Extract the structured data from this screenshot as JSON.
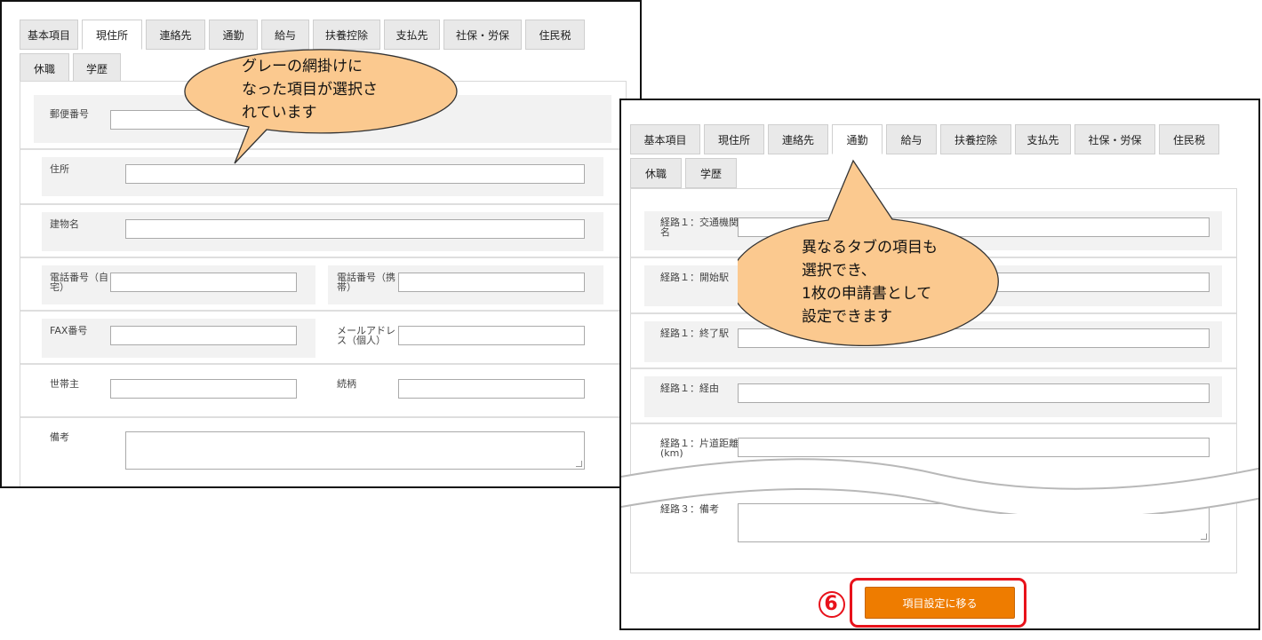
{
  "left_panel": {
    "tabs_row1": [
      "基本項目",
      "現住所",
      "連絡先",
      "通勤",
      "給与",
      "扶養控除",
      "支払先",
      "社保・労保",
      "住民税"
    ],
    "tabs_row2": [
      "休職",
      "学歴"
    ],
    "active_tab": "現住所",
    "fields": {
      "postal_code": "郵便番号",
      "address": "住所",
      "building": "建物名",
      "phone_home": "電話番号（自宅）",
      "phone_mobile": "電話番号（携帯）",
      "fax": "FAX番号",
      "email_personal": "メールアドレス（個人）",
      "householder": "世帯主",
      "relationship": "続柄",
      "remarks": "備考"
    }
  },
  "right_panel": {
    "tabs_row1": [
      "基本項目",
      "現住所",
      "連絡先",
      "通勤",
      "給与",
      "扶養控除",
      "支払先",
      "社保・労保",
      "住民税"
    ],
    "tabs_row2": [
      "休職",
      "学歴"
    ],
    "active_tab": "通勤",
    "fields": {
      "route1_transport": "経路１：交通機関名",
      "route1_start": "経路１：開始駅",
      "route1_end": "経路１：終了駅",
      "route1_via": "経路１：経由",
      "route1_distance": "経路１：片道距離(km)",
      "route3_remarks": "経路３：備考"
    },
    "submit_label": "項目設定に移る"
  },
  "callouts": {
    "left": [
      "グレーの網掛けに",
      "なった項目が選択さ",
      "れています"
    ],
    "right": [
      "異なるタブの項目も",
      "選択でき、",
      "1枚の申請書として",
      "設定できます"
    ]
  },
  "step_number": "6",
  "colors": {
    "bubble_fill": "#fbc98f",
    "button": "#ee7c00",
    "highlight": "#e8121b",
    "tab_inactive": "#e9e9e9",
    "selected_row": "#f2f2f2"
  }
}
